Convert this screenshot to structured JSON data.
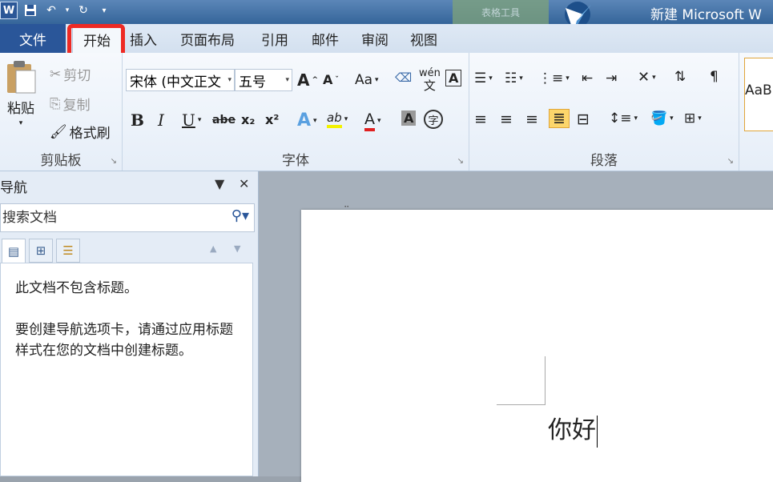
{
  "title_bar": {
    "title": "新建 Microsoft W",
    "context_tab": "表格工具",
    "qat": {
      "app_icon": "W",
      "save": "save-icon",
      "undo": "undo-icon",
      "redo": "redo-icon",
      "customize": "customize-icon"
    }
  },
  "tabs": {
    "file": "文件",
    "items": [
      "开始",
      "插入",
      "页面布局",
      "引用",
      "邮件",
      "审阅",
      "视图"
    ],
    "active": "开始"
  },
  "ribbon": {
    "clipboard": {
      "label": "剪贴板",
      "paste": "粘贴",
      "cut": "剪切",
      "copy": "复制",
      "format_painter": "格式刷"
    },
    "font": {
      "label": "字体",
      "font_name": "宋体 (中文正文",
      "font_size": "五号",
      "grow": "A",
      "shrink": "A",
      "change_case": "Aa",
      "bold": "B",
      "italic": "I",
      "underline": "U",
      "strikethrough": "abe",
      "subscript": "x₂",
      "superscript": "x²",
      "text_effect": "A",
      "highlight": "ab",
      "font_color": "A",
      "char_shading": "A",
      "enclose": "字",
      "phonetic": "wén",
      "border": "A"
    },
    "paragraph": {
      "label": "段落"
    },
    "styles": {
      "preview": "AaB"
    }
  },
  "nav_pane": {
    "title": "导航",
    "search_placeholder": "搜索文档",
    "message1": "此文档不包含标题。",
    "message2": "要创建导航选项卡，请通过应用标题样式在您的文档中创建标题。"
  },
  "document": {
    "text": "你好"
  },
  "colors": {
    "file_tab": "#2a5699",
    "highlight_box": "#ee2a24",
    "title_bar": "#35659a"
  }
}
